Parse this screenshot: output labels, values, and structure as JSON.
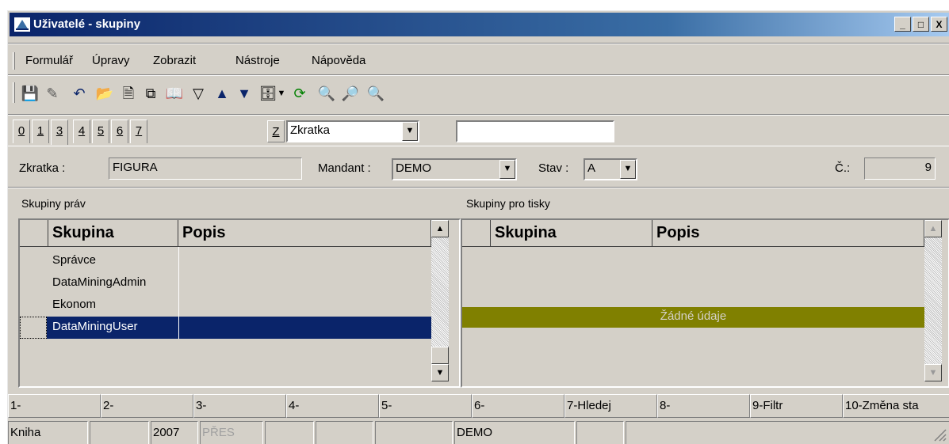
{
  "window": {
    "title": "Uživatelé - skupiny",
    "controls": [
      "_",
      "□",
      "X"
    ]
  },
  "menu": [
    "Formulář",
    "Úpravy",
    "Zobrazit",
    "Nástroje",
    "Nápověda"
  ],
  "toolbar_icons": [
    "save-icon",
    "edit-icon",
    "undo-icon",
    "open-folder-icon",
    "new-document-icon",
    "copy-icon",
    "book-icon",
    "filter-icon",
    "arrow-up-icon",
    "arrow-down-icon",
    "tool-dropdown-icon",
    "chevron-down-icon",
    "refresh-icon",
    "find-icon",
    "find-next-icon",
    "find-previous-icon"
  ],
  "tabs": [
    "0",
    "1",
    "3",
    "4",
    "5",
    "6",
    "7"
  ],
  "tabs_active": "3",
  "search": {
    "key": "Z",
    "field": "Zkratka",
    "value": ""
  },
  "form": {
    "zkratka_label": "Zkratka :",
    "zkratka": "FIGURA",
    "mandant_label": "Mandant :",
    "mandant": "DEMO",
    "stav_label": "Stav :",
    "stav": "A",
    "cislo_label": "Č.:",
    "cislo": "9"
  },
  "rights_groups": {
    "label": "Skupiny práv",
    "columns": [
      "Skupina",
      "Popis"
    ],
    "rows": [
      {
        "skupina": "Správce",
        "popis": ""
      },
      {
        "skupina": "DataMiningAdmin",
        "popis": ""
      },
      {
        "skupina": "Ekonom",
        "popis": ""
      },
      {
        "skupina": "DataMiningUser",
        "popis": ""
      }
    ],
    "selected_index": 3
  },
  "print_groups": {
    "label": "Skupiny pro tisky",
    "columns": [
      "Skupina",
      "Popis"
    ],
    "empty_text": "Žádné údaje"
  },
  "function_keys": [
    "1-",
    "2-",
    "3-",
    "4-",
    "5-",
    "6-",
    "7-Hledej",
    "8-",
    "9-Filtr",
    "10-Změna sta"
  ],
  "status": [
    "Kniha",
    "",
    "2007",
    "PŘES",
    "",
    "",
    "",
    "DEMO",
    "",
    ""
  ],
  "colors": {
    "title_bar": "#0a246a",
    "selection": "#0a246a",
    "empty_bar": "#808000",
    "face": "#d4d0c8"
  }
}
